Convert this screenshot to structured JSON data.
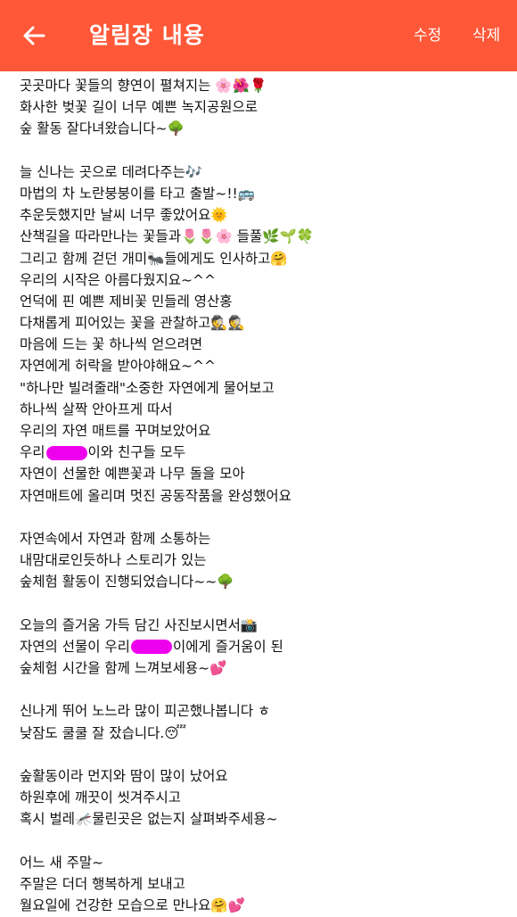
{
  "header": {
    "title": "알림장 내용",
    "edit_label": "수정",
    "delete_label": "삭제"
  },
  "colors": {
    "appbar": "#ff5838",
    "redaction": "#ee00ee"
  },
  "icons": {
    "back": "arrow-left-icon"
  },
  "post": {
    "lines": [
      "곳곳마다 꽃들의 향연이 펼쳐지는 🌸🌺🌹",
      "화사한 벚꽃 길이 너무 예쁜 녹지공원으로",
      "숲 활동 잘다녀왔습니다~🌳",
      "",
      "늘 신나는 곳으로 데려다주는🎶",
      "마법의 차 노란붕붕이를 타고 출발~!!🚌",
      "추운듯했지만 날씨 너무 좋았어요🌞",
      "산책길을 따라만나는 꽃들과🌷🌷🌸 들풀🌿🌱🍀",
      "그리고 함께 걷던 개미🐜들에게도 인사하고🤗",
      "우리의 시작은 아름다웠지요~^^",
      "언덕에 핀 예쁜 제비꽃 민들레 영산홍",
      "다채롭게 피어있는 꽃을 관찰하고🕵️🕵️",
      "마음에 드는 꽃 하나씩 얻으려면",
      "자연에게 허락을 받아야해요~^^",
      "\"하나만 빌려줄래\"소중한 자연에게 물어보고",
      "하나씩 살짝 안아프게 따서",
      "우리의 자연 매트를 꾸며보았어요",
      "우리▮이와 친구들 모두",
      "자연이 선물한 예쁜꽃과 나무 돌을 모아",
      "자연매트에 올리며 멋진 공동작품을 완성했어요",
      "",
      "자연속에서 자연과 함께 소통하는",
      "내맘대로인듯하나 스토리가 있는",
      "숲체험 활동이 진행되었습니다~~🌳",
      "",
      "오늘의 즐거움 가득 담긴 사진보시면서📸",
      "자연의 선물이 우리▮이에게 즐거움이 된",
      "숲체험 시간을 함께 느껴보세용~💕",
      "",
      "신나게 뛰어 노느라 많이 피곤했나봅니다 ㅎ",
      "낮잠도 쿨쿨 잘 잤습니다.😴",
      "",
      "숲활동이라 먼지와 땀이 많이 났어요",
      "하원후에 깨끗이 씻겨주시고",
      "혹시 벌레🦟물린곳은 없는지 살펴봐주세용~",
      "",
      "어느 새 주말~",
      "주말은 더더 행복하게 보내고",
      "월요일에 건강한 모습으로 만나요🤗💕"
    ]
  }
}
